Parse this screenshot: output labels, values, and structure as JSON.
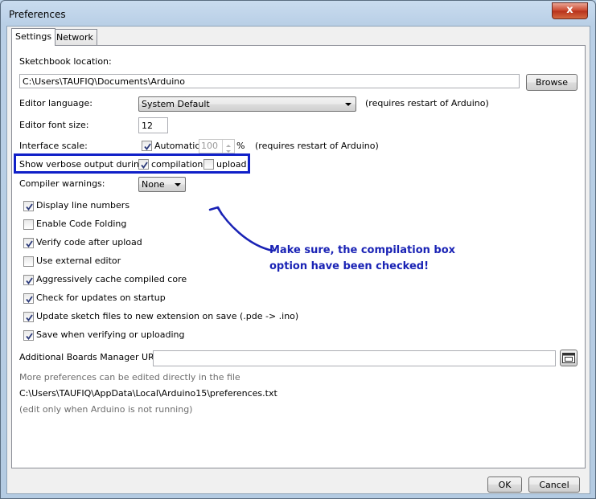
{
  "window": {
    "title": "Preferences",
    "close_glyph": "x"
  },
  "tabs": [
    {
      "label": "Settings"
    },
    {
      "label": "Network"
    }
  ],
  "settings": {
    "sketchbook_label": "Sketchbook location:",
    "sketchbook_value": "C:\\Users\\TAUFIQ\\Documents\\Arduino",
    "browse_label": "Browse",
    "editor_language_label": "Editor language:",
    "editor_language_value": "System Default",
    "editor_language_note": "(requires restart of Arduino)",
    "font_size_label": "Editor font size:",
    "font_size_value": "12",
    "interface_scale_label": "Interface scale:",
    "automatic_label": "Automatic",
    "automatic_checked": true,
    "scale_value": "100",
    "percent_sign": "%",
    "scale_note": "(requires restart of Arduino)",
    "verbose_label": "Show verbose output during:",
    "compilation_label": "compilation",
    "compilation_checked": true,
    "upload_label": "upload",
    "upload_checked": false,
    "compiler_warnings_label": "Compiler warnings:",
    "compiler_warnings_value": "None",
    "options": [
      {
        "label": "Display line numbers",
        "checked": true
      },
      {
        "label": "Enable Code Folding",
        "checked": false
      },
      {
        "label": "Verify code after upload",
        "checked": true
      },
      {
        "label": "Use external editor",
        "checked": false
      },
      {
        "label": "Aggressively cache compiled core",
        "checked": true
      },
      {
        "label": "Check for updates on startup",
        "checked": true
      },
      {
        "label": "Update sketch files to new extension on save (.pde -> .ino)",
        "checked": true
      },
      {
        "label": "Save when verifying or uploading",
        "checked": true
      }
    ],
    "boards_urls_label": "Additional Boards Manager URLs:",
    "boards_urls_value": "",
    "more_prefs_text": "More preferences can be edited directly in the file",
    "prefs_path": "C:\\Users\\TAUFIQ\\AppData\\Local\\Arduino15\\preferences.txt",
    "edit_note": "(edit only when Arduino is not running)"
  },
  "footer": {
    "ok_label": "OK",
    "cancel_label": "Cancel"
  },
  "annotation": {
    "line1": "Make sure, the compilation box",
    "line2": "option have been checked!",
    "color": "#1a23b5"
  },
  "icons": {
    "check": "check-icon",
    "dropdown": "chevron-down-icon",
    "boards_button": "window-edit-icon"
  }
}
